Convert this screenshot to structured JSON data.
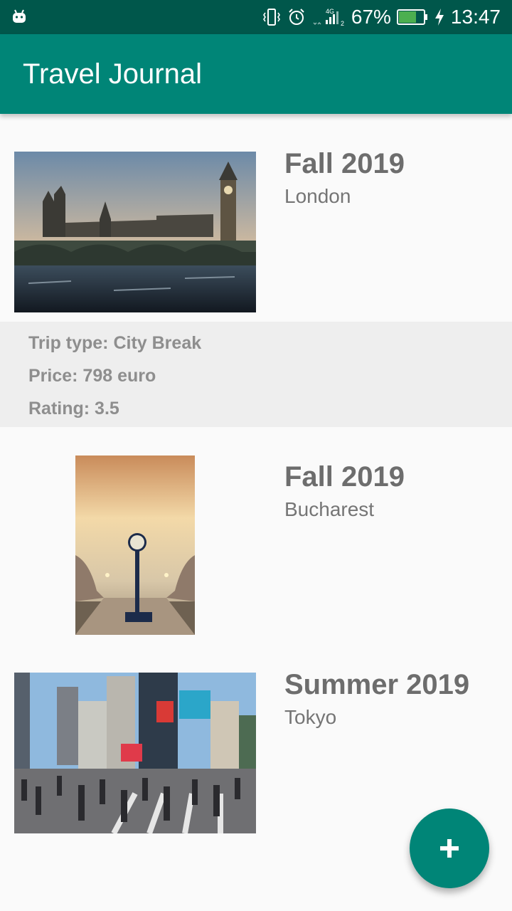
{
  "status_bar": {
    "battery_percent": "67%",
    "time": "13:47",
    "network": "4G",
    "icons": [
      "android-icon",
      "vibrate-icon",
      "alarm-icon",
      "signal-icon",
      "battery-icon",
      "charging-bolt-icon"
    ]
  },
  "app_bar": {
    "title": "Travel Journal"
  },
  "trips": [
    {
      "season": "Fall 2019",
      "city": "London",
      "image": "london-photo"
    },
    {
      "season": "Fall 2019",
      "city": "Bucharest",
      "image": "bucharest-photo"
    },
    {
      "season": "Summer 2019",
      "city": "Tokyo",
      "image": "tokyo-photo"
    }
  ],
  "expanded_details": {
    "trip_type": "Trip type: City Break",
    "price": "Price: 798 euro",
    "rating": "Rating: 3.5"
  },
  "fab": {
    "icon": "plus-icon"
  },
  "colors": {
    "primary": "#008577",
    "primary_dark": "#00574b",
    "battery": "#4caf50"
  }
}
